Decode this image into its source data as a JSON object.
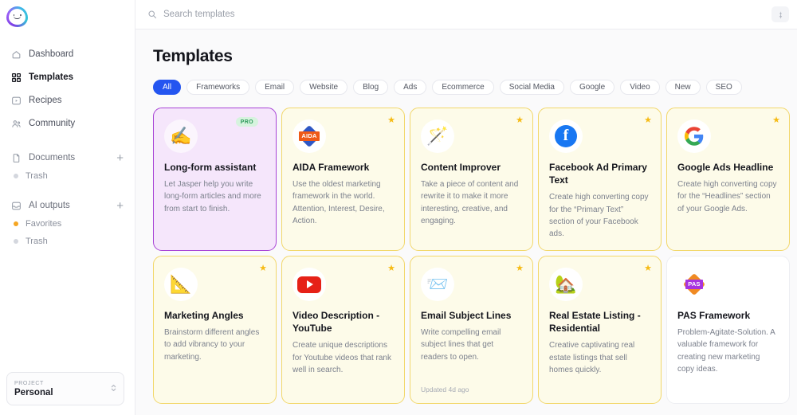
{
  "brand": {
    "logo_name": "jasper-logo"
  },
  "sidebar": {
    "nav": [
      {
        "label": "Dashboard",
        "icon": "home-icon",
        "active": false
      },
      {
        "label": "Templates",
        "icon": "grid-icon",
        "active": true
      },
      {
        "label": "Recipes",
        "icon": "play-square-icon",
        "active": false
      },
      {
        "label": "Community",
        "icon": "people-icon",
        "active": false
      }
    ],
    "groups": [
      {
        "label": "Documents",
        "icon": "file-icon",
        "add_label": "+",
        "children": [
          {
            "label": "Trash",
            "dot_color": "#d4d7de"
          }
        ]
      },
      {
        "label": "AI outputs",
        "icon": "inbox-icon",
        "add_label": "+",
        "children": [
          {
            "label": "Favorites",
            "dot_color": "#f5a623"
          },
          {
            "label": "Trash",
            "dot_color": "#d4d7de"
          }
        ]
      }
    ],
    "project": {
      "label": "PROJECT",
      "name": "Personal",
      "caret": "chevron-up-down-icon"
    }
  },
  "topbar": {
    "search_placeholder": "Search templates",
    "search_value": "",
    "search_icon": "search-icon",
    "action_icon": "sparkle-icon"
  },
  "main": {
    "title": "Templates",
    "tabs": [
      {
        "label": "All",
        "active": true
      },
      {
        "label": "Frameworks",
        "active": false
      },
      {
        "label": "Email",
        "active": false
      },
      {
        "label": "Website",
        "active": false
      },
      {
        "label": "Blog",
        "active": false
      },
      {
        "label": "Ads",
        "active": false
      },
      {
        "label": "Ecommerce",
        "active": false
      },
      {
        "label": "Social Media",
        "active": false
      },
      {
        "label": "Google",
        "active": false
      },
      {
        "label": "Video",
        "active": false
      },
      {
        "label": "New",
        "active": false
      },
      {
        "label": "SEO",
        "active": false
      }
    ],
    "cards": [
      {
        "title": "Long-form assistant",
        "desc": "Let Jasper help you write long-form articles and more from start to finish.",
        "icon": "writing-hand-icon",
        "emoji": "✍️",
        "style": "pro",
        "badge": "PRO",
        "starred": false,
        "updated": ""
      },
      {
        "title": "AIDA Framework",
        "desc": "Use the oldest marketing framework in the world. Attention, Interest, Desire, Action.",
        "icon": "aida-icon",
        "emoji": "",
        "style": "fav",
        "badge": "",
        "starred": true,
        "updated": ""
      },
      {
        "title": "Content Improver",
        "desc": "Take a piece of content and rewrite it to make it more interesting, creative, and engaging.",
        "icon": "magic-wand-icon",
        "emoji": "🪄",
        "style": "fav",
        "badge": "",
        "starred": true,
        "updated": ""
      },
      {
        "title": "Facebook Ad Primary Text",
        "desc": "Create high converting copy for the “Primary Text” section of your Facebook ads.",
        "icon": "facebook-icon",
        "emoji": "",
        "style": "fav",
        "badge": "",
        "starred": true,
        "updated": ""
      },
      {
        "title": "Google Ads Headline",
        "desc": "Create high converting copy for the “Headlines” section of your Google Ads.",
        "icon": "google-icon",
        "emoji": "",
        "style": "fav",
        "badge": "",
        "starred": true,
        "updated": ""
      },
      {
        "title": "Marketing Angles",
        "desc": "Brainstorm different angles to add vibrancy to your marketing.",
        "icon": "triangular-ruler-icon",
        "emoji": "📐",
        "style": "fav",
        "badge": "",
        "starred": true,
        "updated": ""
      },
      {
        "title": "Video Description - YouTube",
        "desc": "Create unique descriptions for Youtube videos that rank well in search.",
        "icon": "youtube-icon",
        "emoji": "",
        "style": "fav",
        "badge": "",
        "starred": true,
        "updated": ""
      },
      {
        "title": "Email Subject Lines",
        "desc": "Write compelling email subject lines that get readers to open.",
        "icon": "incoming-envelope-icon",
        "emoji": "📨",
        "style": "fav",
        "badge": "",
        "starred": true,
        "updated": "Updated 4d ago"
      },
      {
        "title": "Real Estate Listing - Residential",
        "desc": "Creative captivating real estate listings that sell homes quickly.",
        "icon": "house-with-garden-icon",
        "emoji": "🏡",
        "style": "fav",
        "badge": "",
        "starred": true,
        "updated": ""
      },
      {
        "title": "PAS Framework",
        "desc": "Problem-Agitate-Solution. A valuable framework for creating new marketing copy ideas.",
        "icon": "pas-icon",
        "emoji": "",
        "style": "plain",
        "badge": "",
        "starred": false,
        "updated": ""
      }
    ]
  },
  "colors": {
    "accent_blue": "#2455f0",
    "star_gold": "#f6bb15",
    "fav_card_bg": "#fdfbe9",
    "fav_card_border": "#f2d76a",
    "pro_card_bg": "#f5e6fb",
    "pro_card_border": "#a843d6",
    "pro_badge_bg": "#d6f3de",
    "pro_badge_text": "#2f9b5c"
  }
}
